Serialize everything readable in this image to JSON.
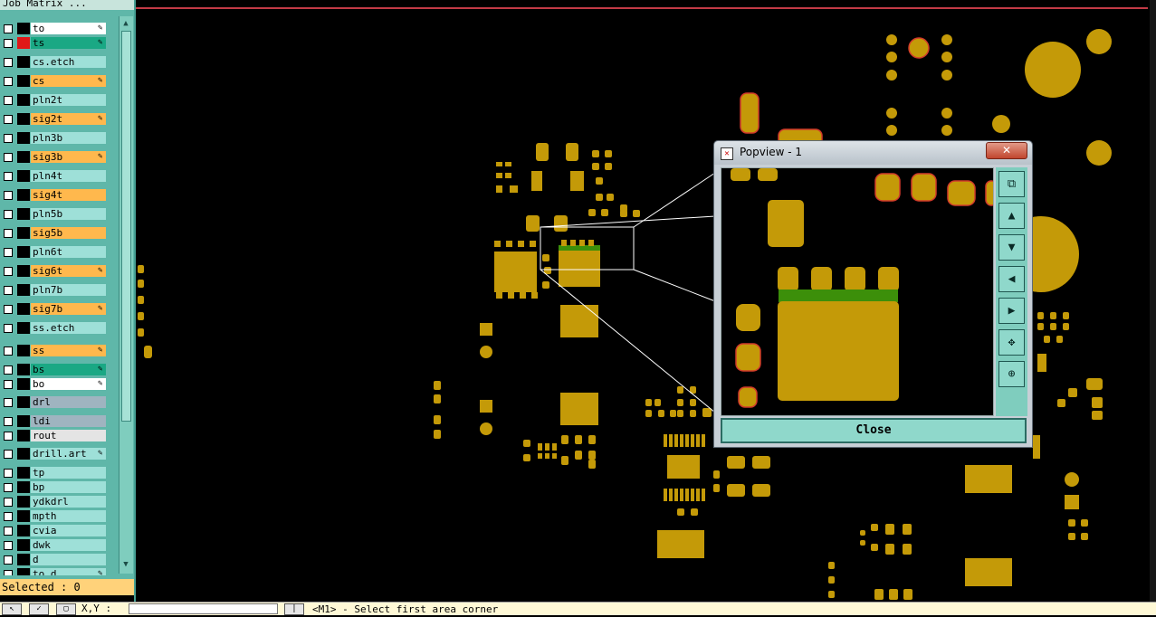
{
  "panel": {
    "title": "Job Matrix ...",
    "selected_label": "Selected : 0",
    "layers": [
      {
        "name": "to",
        "color": "#ffffff",
        "swatch": "#000000",
        "pen": true
      },
      {
        "name": "ts",
        "color": "#1aa884",
        "swatch": "#e01818",
        "pen": true
      },
      {
        "name": "cs.etch",
        "color": "#9ee0d8",
        "swatch": "#000000",
        "pen": false
      },
      {
        "name": "cs",
        "color": "#ffb84d",
        "swatch": "#000000",
        "pen": true
      },
      {
        "name": "pln2t",
        "color": "#9ee0d8",
        "swatch": "#000000",
        "pen": false
      },
      {
        "name": "sig2t",
        "color": "#ffb84d",
        "swatch": "#000000",
        "pen": true
      },
      {
        "name": "pln3b",
        "color": "#9ee0d8",
        "swatch": "#000000",
        "pen": false
      },
      {
        "name": "sig3b",
        "color": "#ffb84d",
        "swatch": "#000000",
        "pen": true
      },
      {
        "name": "pln4t",
        "color": "#9ee0d8",
        "swatch": "#000000",
        "pen": false
      },
      {
        "name": "sig4t",
        "color": "#ffb84d",
        "swatch": "#000000",
        "pen": false
      },
      {
        "name": "pln5b",
        "color": "#9ee0d8",
        "swatch": "#000000",
        "pen": false
      },
      {
        "name": "sig5b",
        "color": "#ffb84d",
        "swatch": "#000000",
        "pen": false
      },
      {
        "name": "pln6t",
        "color": "#9ee0d8",
        "swatch": "#000000",
        "pen": false
      },
      {
        "name": "sig6t",
        "color": "#ffb84d",
        "swatch": "#000000",
        "pen": true
      },
      {
        "name": "pln7b",
        "color": "#9ee0d8",
        "swatch": "#000000",
        "pen": false
      },
      {
        "name": "sig7b",
        "color": "#ffb84d",
        "swatch": "#000000",
        "pen": true
      },
      {
        "name": "ss.etch",
        "color": "#9ee0d8",
        "swatch": "#000000",
        "pen": false
      },
      {
        "name": "ss",
        "color": "#ffb84d",
        "swatch": "#000000",
        "pen": true
      },
      {
        "name": "bs",
        "color": "#1aa884",
        "swatch": "#000000",
        "pen": true
      },
      {
        "name": "bo",
        "color": "#ffffff",
        "swatch": "#000000",
        "pen": true
      },
      {
        "name": "drl",
        "color": "#9fb4c0",
        "swatch": "#000000",
        "pen": false
      },
      {
        "name": "ldi",
        "color": "#9fb4c0",
        "swatch": "#000000",
        "pen": false
      },
      {
        "name": "rout",
        "color": "#e4e4e4",
        "swatch": "#000000",
        "pen": false
      },
      {
        "name": "drill.art",
        "color": "#9ee0d8",
        "swatch": "#000000",
        "pen": true
      },
      {
        "name": "tp",
        "color": "#9ee0d8",
        "swatch": "#000000",
        "pen": false
      },
      {
        "name": "bp",
        "color": "#9ee0d8",
        "swatch": "#000000",
        "pen": false
      },
      {
        "name": "ydkdrl",
        "color": "#9ee0d8",
        "swatch": "#000000",
        "pen": false
      },
      {
        "name": "mpth",
        "color": "#9ee0d8",
        "swatch": "#000000",
        "pen": false
      },
      {
        "name": "cvia",
        "color": "#9ee0d8",
        "swatch": "#000000",
        "pen": false
      },
      {
        "name": "dwk",
        "color": "#9ee0d8",
        "swatch": "#000000",
        "pen": false
      },
      {
        "name": "d",
        "color": "#9ee0d8",
        "swatch": "#000000",
        "pen": false
      },
      {
        "name": "to.d",
        "color": "#9ee0d8",
        "swatch": "#000000",
        "pen": true
      }
    ]
  },
  "popview": {
    "title": "Popview - 1",
    "close_label": "Close",
    "close_x": "✕",
    "tools": [
      {
        "name": "zoom-window-icon",
        "glyph": "⧉"
      },
      {
        "name": "pan-up-icon",
        "glyph": "▲"
      },
      {
        "name": "pan-down-icon",
        "glyph": "▼"
      },
      {
        "name": "pan-left-icon",
        "glyph": "◀"
      },
      {
        "name": "pan-right-icon",
        "glyph": "▶"
      },
      {
        "name": "zoom-in-icon",
        "glyph": "✥"
      },
      {
        "name": "zoom-out-icon",
        "glyph": "⊕"
      }
    ]
  },
  "statusbar": {
    "xy_label": "X,Y :",
    "message": "<M1> - Select first area corner"
  },
  "colors": {
    "pad": "#c49a08",
    "pad_outline": "#d23a2a",
    "mask": "#3c8f0a",
    "panel_bg": "#5fb7a9"
  }
}
